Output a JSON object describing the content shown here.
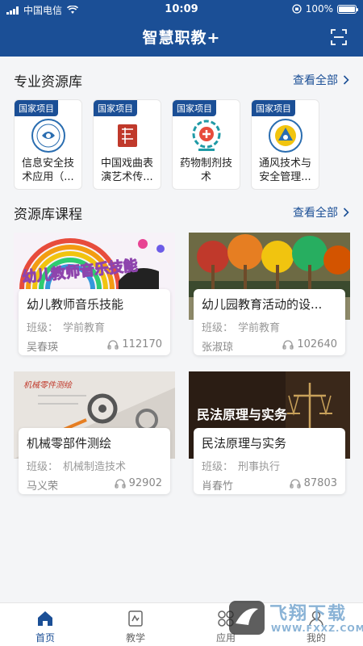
{
  "status_bar": {
    "carrier": "中国电信",
    "time": "10:09",
    "battery": "100%",
    "battery_level": 1.0
  },
  "header": {
    "title": "智慧职教+",
    "scan_icon": "scan-icon"
  },
  "resource_section": {
    "title": "专业资源库",
    "more_label": "查看全部"
  },
  "resources": [
    {
      "tag": "国家项目",
      "name": "信息安全技术应用（...",
      "logo_color": "#2a6db0"
    },
    {
      "tag": "国家项目",
      "name": "中国戏曲表演艺术传...",
      "logo_color": "#c0392b"
    },
    {
      "tag": "国家项目",
      "name": "药物制剂技术",
      "logo_color": "#1f9aa6"
    },
    {
      "tag": "国家项目",
      "name": "通风技术与安全管理...",
      "logo_color": "#2a6db0"
    }
  ],
  "course_section": {
    "title": "资源库课程",
    "more_label": "查看全部"
  },
  "courses": [
    {
      "title": "幼儿教师音乐技能",
      "class_label": "班级：",
      "class_value": "学前教育",
      "teacher": "吴春瑛",
      "views": "112170",
      "banner_text": "幼儿教师音乐技能"
    },
    {
      "title": "幼儿园教育活动的设...",
      "class_label": "班级：",
      "class_value": "学前教育",
      "teacher": "张淑琼",
      "views": "102640"
    },
    {
      "title": "机械零部件测绘",
      "class_label": "班级：",
      "class_value": "机械制造技术",
      "teacher": "马义荣",
      "views": "92902",
      "banner_text": "机械零件测绘"
    },
    {
      "title": "民法原理与实务",
      "class_label": "班级：",
      "class_value": "刑事执行",
      "teacher": "肖春竹",
      "views": "87803",
      "banner_text": "民法原理与实务"
    }
  ],
  "tabbar": {
    "items": [
      {
        "label": "首页",
        "icon": "home-icon",
        "active": true
      },
      {
        "label": "教学",
        "icon": "teach-icon",
        "active": false
      },
      {
        "label": "应用",
        "icon": "apps-icon",
        "active": false
      },
      {
        "label": "我的",
        "icon": "profile-icon",
        "active": false
      }
    ]
  },
  "watermark": {
    "brand": "飞翔下载",
    "url": "WWW.FXXZ.COM"
  },
  "colors": {
    "primary": "#1b4f96",
    "background": "#f4f5f7"
  }
}
